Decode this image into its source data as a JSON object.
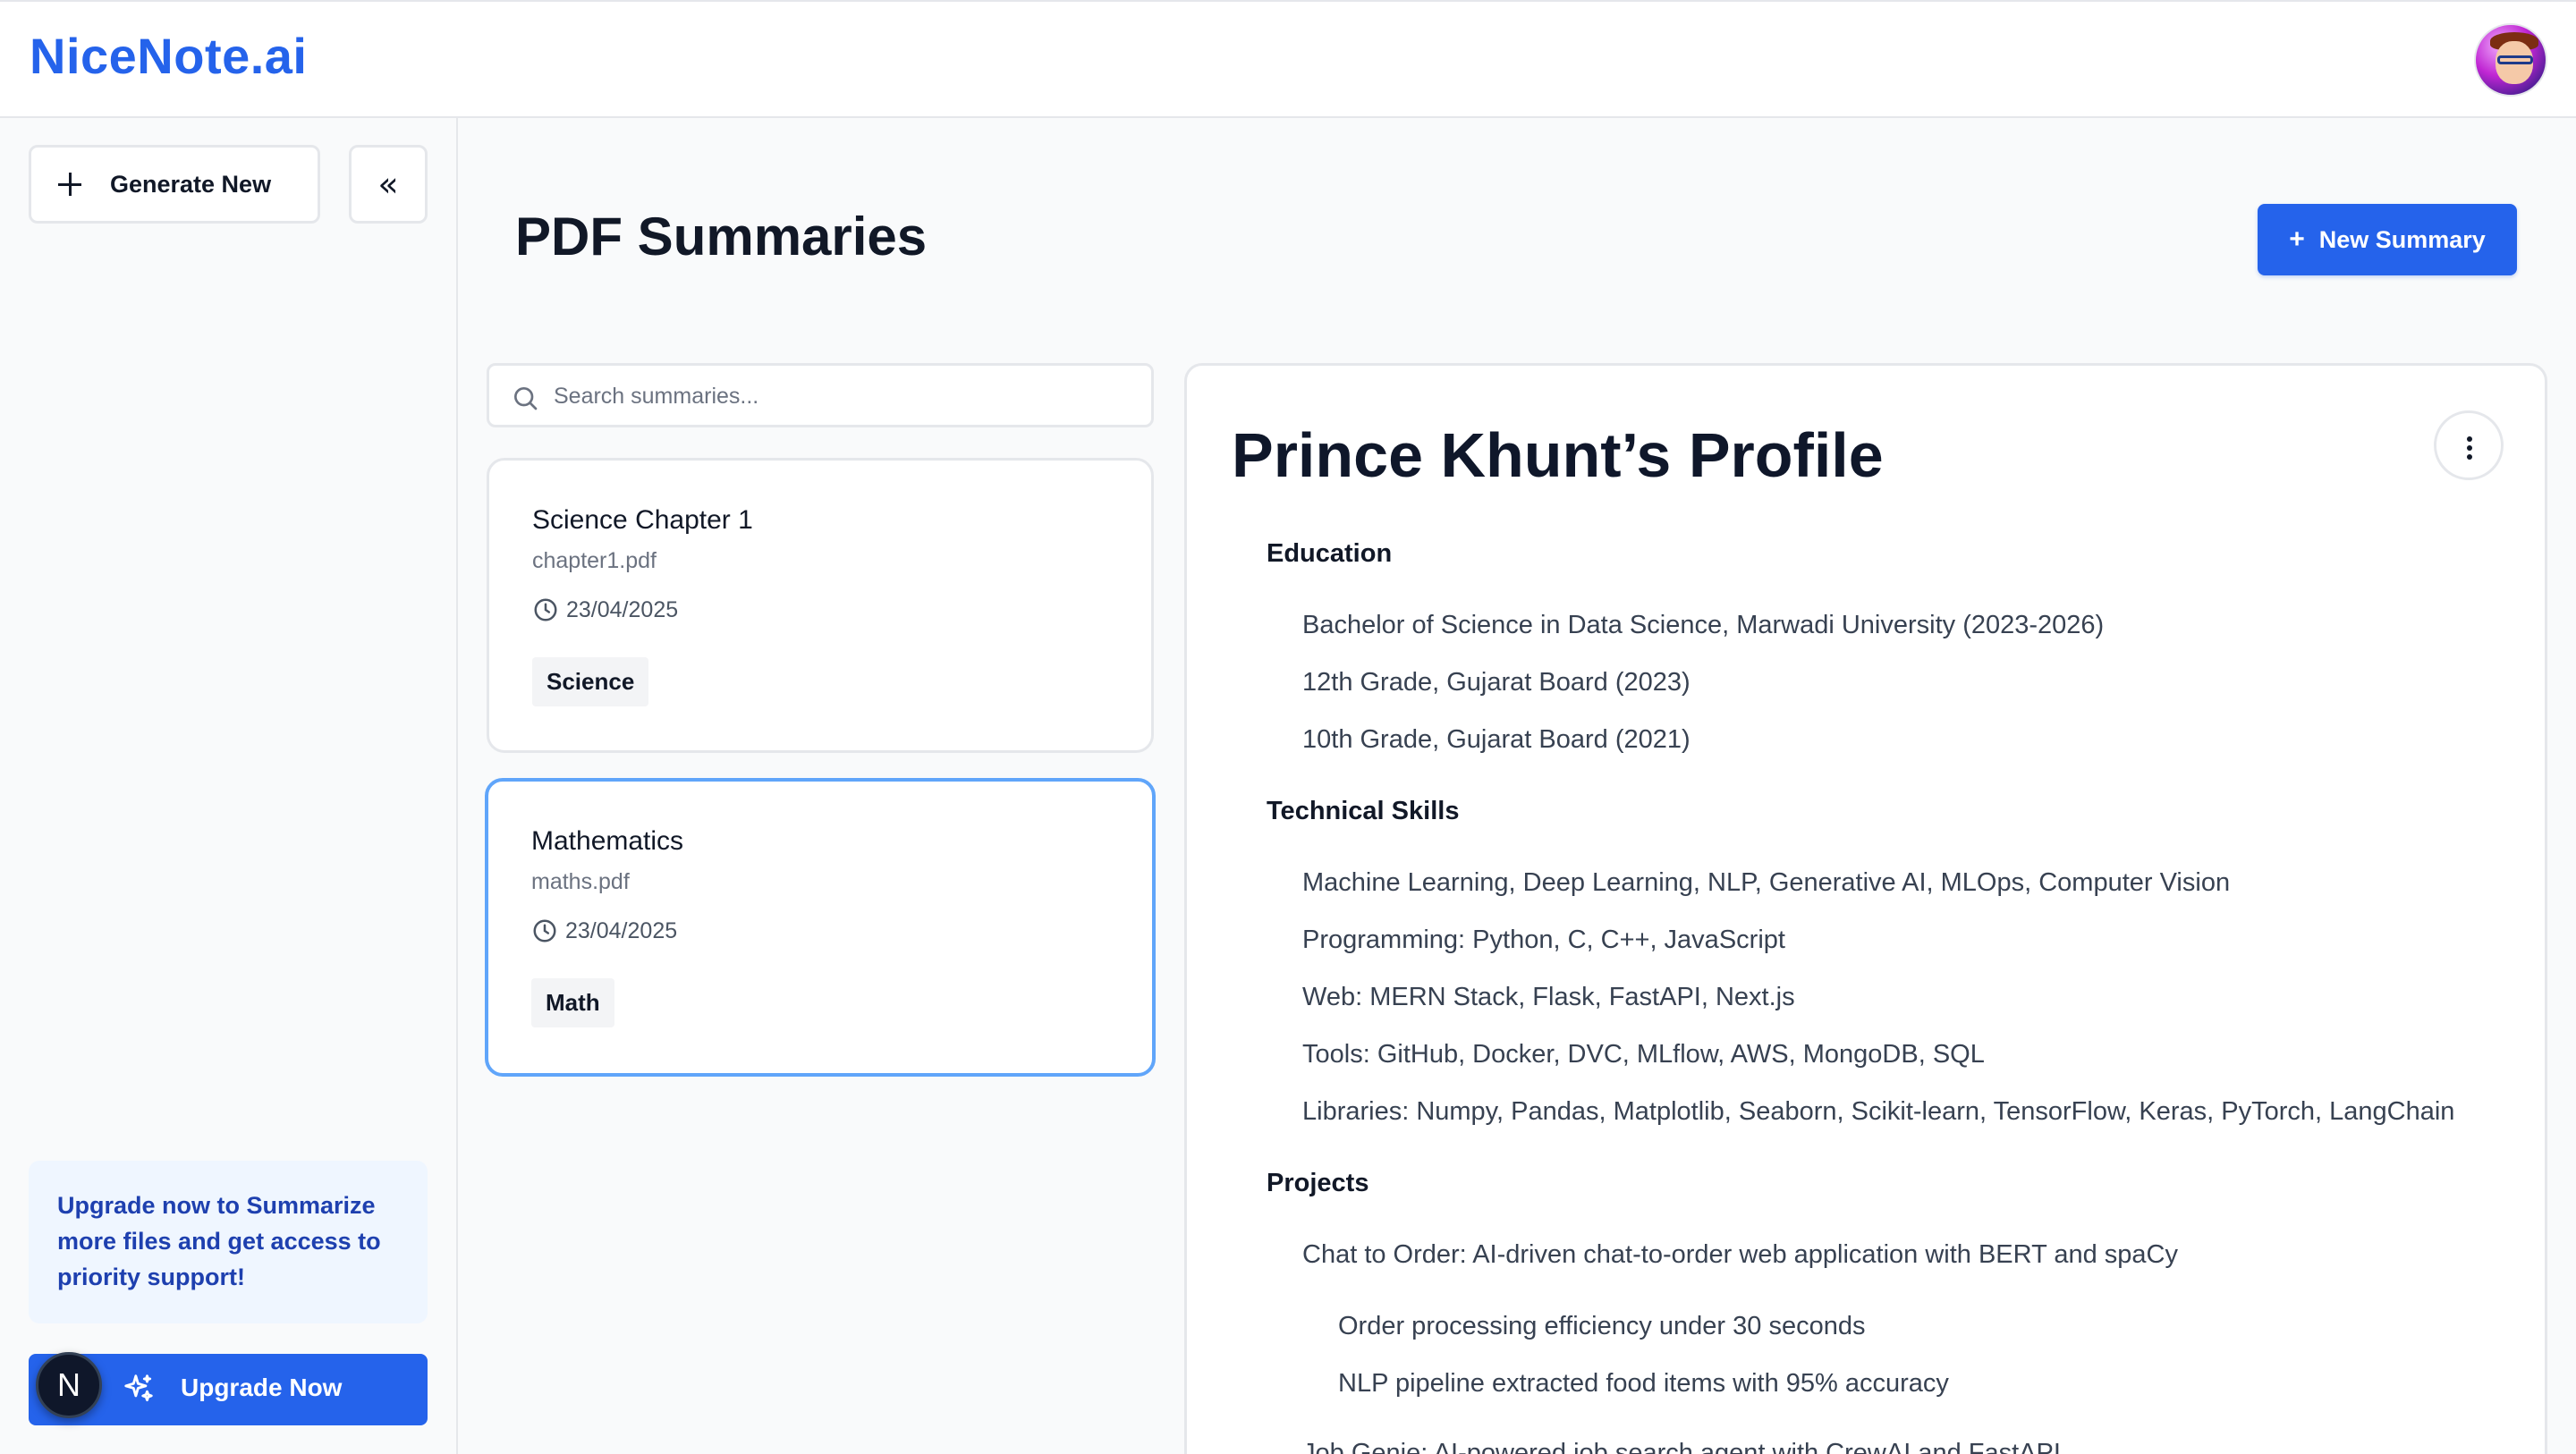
{
  "app": {
    "brand": "NiceNote.ai"
  },
  "sidebar": {
    "generate_label": "Generate New",
    "collapse_glyph": "«",
    "upgrade_note": "Upgrade now to Summarize more files and get access to priority support!",
    "upgrade_button": "Upgrade Now",
    "next_badge": "N"
  },
  "main": {
    "title": "PDF Summaries",
    "new_summary_label": "New Summary",
    "search_placeholder": "Search summaries...",
    "cards": [
      {
        "title": "Science Chapter 1",
        "file": "chapter1.pdf",
        "date": "23/04/2025",
        "tag": "Science"
      },
      {
        "title": "Mathematics",
        "file": "maths.pdf",
        "date": "23/04/2025",
        "tag": "Math"
      }
    ]
  },
  "detail": {
    "heading": "Prince Khunt’s Profile",
    "sections": {
      "education": {
        "title": "Education",
        "items": [
          "Bachelor of Science in Data Science, Marwadi University (2023-2026)",
          "12th Grade, Gujarat Board (2023)",
          "10th Grade, Gujarat Board (2021)"
        ]
      },
      "skills": {
        "title": "Technical Skills",
        "items": [
          "Machine Learning, Deep Learning, NLP, Generative AI, MLOps, Computer Vision",
          "Programming: Python, C, C++, JavaScript",
          "Web: MERN Stack, Flask, FastAPI, Next.js",
          "Tools: GitHub, Docker, DVC, MLflow, AWS, MongoDB, SQL",
          "Libraries: Numpy, Pandas, Matplotlib, Seaborn, Scikit-learn, TensorFlow, Keras, PyTorch, LangChain"
        ]
      },
      "projects": {
        "title": "Projects",
        "items": [
          "Chat to Order: AI-driven chat-to-order web application with BERT and spaCy",
          "Job Genie: AI-powered job search agent with CrewAI and FastAPI"
        ],
        "sub_items": [
          "Order processing efficiency under 30 seconds",
          "NLP pipeline extracted food items with 95% accuracy"
        ]
      }
    }
  },
  "colors": {
    "accent": "#2563eb",
    "selected_border": "#60a5fa",
    "upgrade_bg": "#eff6ff"
  },
  "icons": [
    "plus-icon",
    "double-chevron-left-icon",
    "sparkle-icon",
    "search-icon",
    "clock-icon",
    "more-vertical-icon",
    "avatar",
    "nextjs-badge"
  ]
}
